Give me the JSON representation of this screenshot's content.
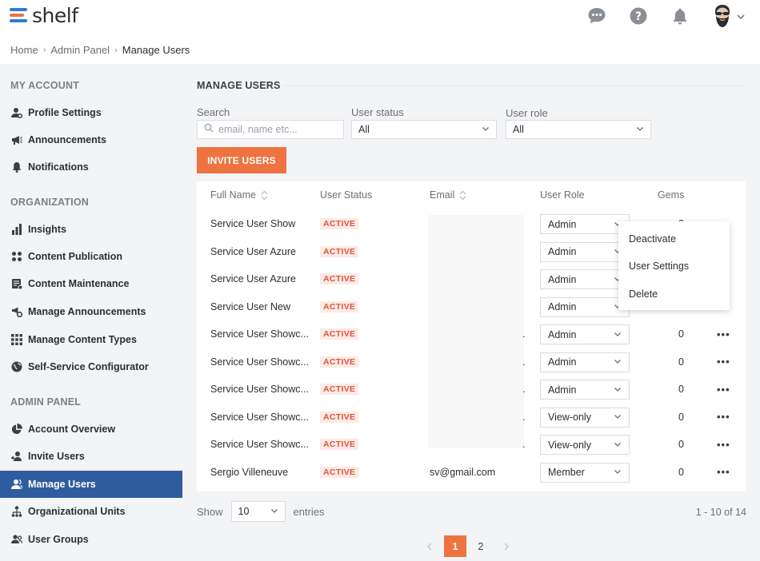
{
  "app": {
    "name": "shelf"
  },
  "colors": {
    "accent": "#ee7340",
    "nav_active": "#2f5c9e",
    "status": "#e0553d",
    "logo_blue": "#2f7bd6"
  },
  "header": {
    "icons": [
      "chat-icon",
      "help-icon",
      "bell-icon",
      "avatar",
      "chevron-down-icon"
    ]
  },
  "breadcrumb": {
    "items": [
      "Home",
      "Admin Panel",
      "Manage Users"
    ]
  },
  "sidebar": {
    "sections": [
      {
        "title": "MY ACCOUNT",
        "items": [
          {
            "label": "Profile Settings",
            "icon": "profile-settings-icon"
          },
          {
            "label": "Announcements",
            "icon": "megaphone-icon"
          },
          {
            "label": "Notifications",
            "icon": "bell-icon"
          }
        ]
      },
      {
        "title": "ORGANIZATION",
        "items": [
          {
            "label": "Insights",
            "icon": "bar-chart-icon"
          },
          {
            "label": "Content Publication",
            "icon": "grid-dots-icon"
          },
          {
            "label": "Content Maintenance",
            "icon": "document-check-icon"
          },
          {
            "label": "Manage Announcements",
            "icon": "megaphone-gear-icon"
          },
          {
            "label": "Manage Content Types",
            "icon": "grid-icon"
          },
          {
            "label": "Self-Service Configurator",
            "icon": "globe-icon"
          }
        ]
      },
      {
        "title": "ADMIN PANEL",
        "items": [
          {
            "label": "Account Overview",
            "icon": "pie-chart-icon"
          },
          {
            "label": "Invite Users",
            "icon": "add-user-icon"
          },
          {
            "label": "Manage Users",
            "icon": "users-icon",
            "active": true
          },
          {
            "label": "Organizational Units",
            "icon": "org-tree-icon"
          },
          {
            "label": "User Groups",
            "icon": "user-group-icon"
          }
        ]
      }
    ]
  },
  "main": {
    "title": "MANAGE USERS",
    "filters": {
      "search": {
        "label": "Search",
        "placeholder": "email, name etc...",
        "value": ""
      },
      "status": {
        "label": "User status",
        "value": "All"
      },
      "role": {
        "label": "User role",
        "value": "All"
      }
    },
    "invite_label": "INVITE USERS",
    "table": {
      "columns": [
        "Full Name",
        "User Status",
        "Email",
        "User Role",
        "Gems"
      ],
      "rows": [
        {
          "name": "Service User Show",
          "status": "ACTIVE",
          "email": "",
          "role": "Admin",
          "gems": "0"
        },
        {
          "name": "Service User Azure",
          "status": "ACTIVE",
          "email": "",
          "role": "Admin",
          "gems": ""
        },
        {
          "name": "Service User Azure",
          "status": "ACTIVE",
          "email": "",
          "role": "Admin",
          "gems": ""
        },
        {
          "name": "Service User New",
          "status": "ACTIVE",
          "email": "",
          "role": "Admin",
          "gems": ""
        },
        {
          "name": "Service User Showc...",
          "status": "ACTIVE",
          "email": ".",
          "role": "Admin",
          "gems": "0"
        },
        {
          "name": "Service User Showc...",
          "status": "ACTIVE",
          "email": ".",
          "role": "Admin",
          "gems": "0"
        },
        {
          "name": "Service User Showc...",
          "status": "ACTIVE",
          "email": ".",
          "role": "Admin",
          "gems": "0"
        },
        {
          "name": "Service User Showc...",
          "status": "ACTIVE",
          "email": ".",
          "role": "View-only",
          "gems": "0"
        },
        {
          "name": "Service User Showc...",
          "status": "ACTIVE",
          "email": ".",
          "role": "View-only",
          "gems": "0"
        },
        {
          "name": "Sergio Villeneuve",
          "status": "ACTIVE",
          "email": "sv@gmail.com",
          "role": "Member",
          "gems": "0"
        }
      ]
    },
    "context_menu": {
      "items": [
        "Deactivate",
        "User Settings",
        "Delete"
      ]
    },
    "footer": {
      "show_label": "Show",
      "entries_value": "10",
      "entries_label": "entries",
      "range": "1 - 10 of 14",
      "pages": [
        "1",
        "2"
      ],
      "current_page": "1"
    }
  }
}
